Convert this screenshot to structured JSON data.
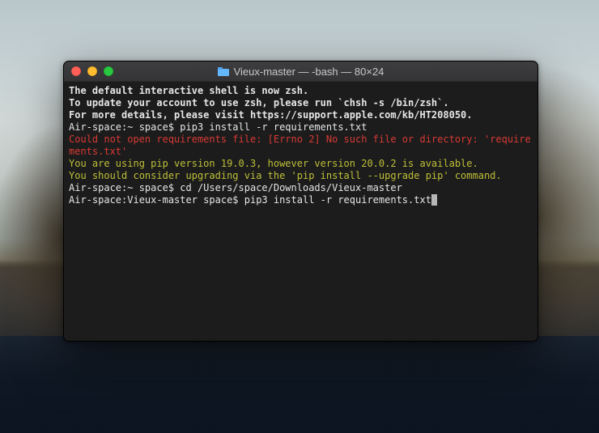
{
  "window": {
    "title": "Vieux-master — -bash — 80×24"
  },
  "colors": {
    "bg": "#1c1c1c",
    "text": "#e6e6e6",
    "error": "#d83a34",
    "warn": "#bfbf3a"
  },
  "terminal": {
    "lines": [
      {
        "text": "",
        "color": "default"
      },
      {
        "text": "The default interactive shell is now zsh.",
        "color": "default",
        "bold": true
      },
      {
        "text": "To update your account to use zsh, please run `chsh -s /bin/zsh`.",
        "color": "default",
        "bold": true
      },
      {
        "text": "For more details, please visit https://support.apple.com/kb/HT208050.",
        "color": "default",
        "bold": true
      },
      {
        "text": "Air-space:~ space$ pip3 install -r requirements.txt",
        "color": "default"
      },
      {
        "text": "Could not open requirements file: [Errno 2] No such file or directory: 'requirements.txt'",
        "color": "red"
      },
      {
        "text": "You are using pip version 19.0.3, however version 20.0.2 is available.",
        "color": "yellow"
      },
      {
        "text": "You should consider upgrading via the 'pip install --upgrade pip' command.",
        "color": "yellow"
      },
      {
        "text": "Air-space:~ space$ cd /Users/space/Downloads/Vieux-master",
        "color": "default"
      },
      {
        "text": "Air-space:Vieux-master space$ pip3 install -r requirements.txt",
        "color": "default",
        "cursor": true
      }
    ]
  }
}
